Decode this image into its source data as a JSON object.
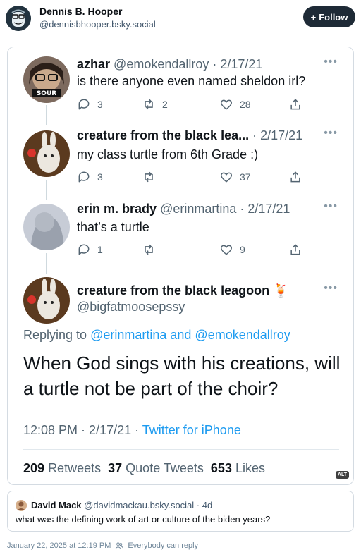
{
  "author": {
    "name": "Dennis B. Hooper",
    "handle": "@dennisbhooper.bsky.social"
  },
  "follow_label": "Follow",
  "embed": {
    "tweets": [
      {
        "name": "azhar",
        "handle_date": "@emokendallroy · 2/17/21",
        "text": "is there anyone even named sheldon irl?",
        "replies": "3",
        "retweets": "2",
        "likes": "28",
        "avatar_label": "SOUR"
      },
      {
        "name": "creature from the black lea...",
        "handle_date": "· 2/17/21",
        "text": "my class turtle from 6th Grade :)",
        "replies": "3",
        "retweets": "",
        "likes": "37"
      },
      {
        "name": "erin m. brady",
        "handle_date": "@erinmartina · 2/17/21",
        "text": "that’s a turtle",
        "replies": "1",
        "retweets": "",
        "likes": "9"
      }
    ],
    "main": {
      "name": "creature from the black leagoon",
      "emoji": "🍹",
      "handle": "@bigfatmoosepssy",
      "replying_prefix": "Replying to",
      "replying_users": "@erinmartina and @emokendallroy",
      "text": "When God sings with his creations, will a turtle not be part of the choir?",
      "time": "12:08 PM · 2/17/21 ·",
      "source": "Twitter for iPhone",
      "retweets_count": "209",
      "retweets_label": "Retweets",
      "quotes_count": "37",
      "quotes_label": "Quote Tweets",
      "likes_count": "653",
      "likes_label": "Likes"
    },
    "alt_label": "ALT"
  },
  "quote": {
    "name": "David Mack",
    "handle_date": "@davidmackau.bsky.social · 4d",
    "text": "what was the defining work of art or culture of the biden years?"
  },
  "footer": {
    "timestamp": "January 22, 2025 at 12:19 PM",
    "reply_setting": "Everybody can reply"
  },
  "colors": {
    "follow_bg": "#1e2a36",
    "link": "#1d9bf0",
    "muted": "#536471"
  }
}
